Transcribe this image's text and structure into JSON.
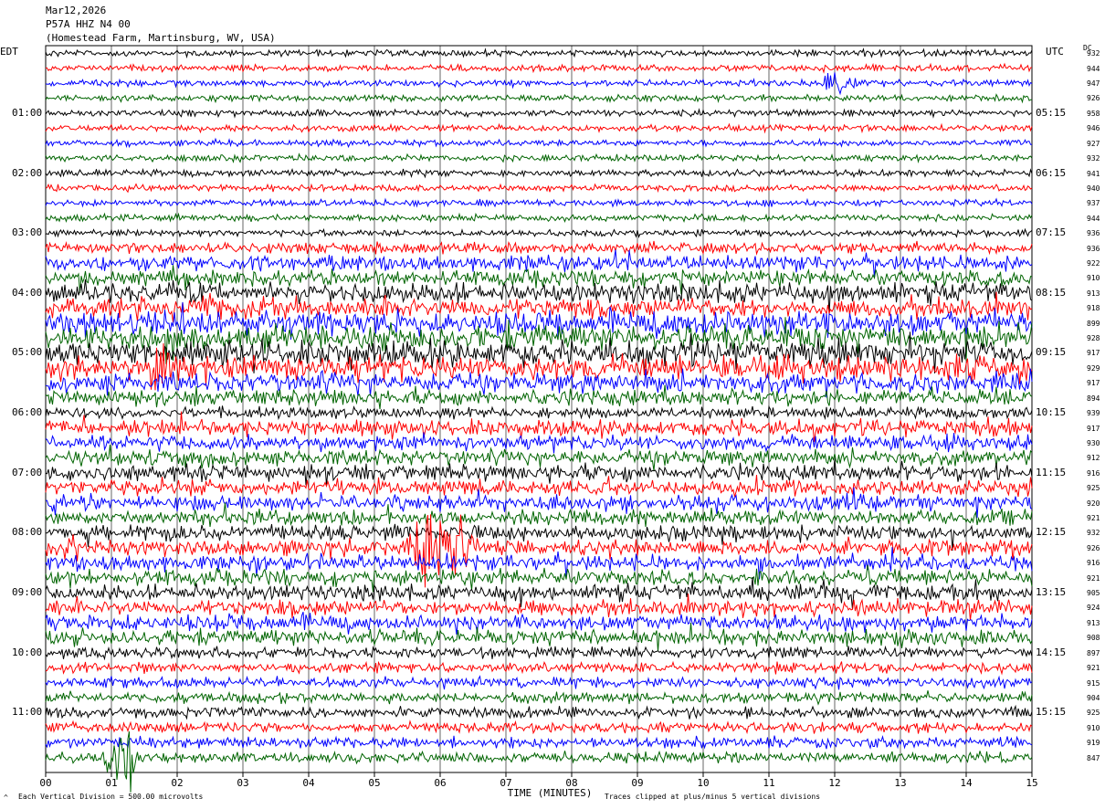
{
  "header": {
    "date": "Mar12,2026",
    "station": "P57A HHZ N4 00",
    "location": "(Homestead Farm, Martinsburg, WV, USA)"
  },
  "left_timezone": "EDT",
  "right_timezone": "UTC",
  "dc_label": "DC",
  "footer": {
    "scale_note": "Each Vertical Division = 500.00 microvolts",
    "clip_note": "Traces clipped at plus/minus 5 vertical divisions",
    "corner_mark": "^"
  },
  "chart_data": {
    "type": "line",
    "title": "",
    "xlabel": "TIME (MINUTES)",
    "xlim": [
      0,
      15
    ],
    "x_ticks": [
      "00",
      "01",
      "02",
      "03",
      "04",
      "05",
      "06",
      "07",
      "08",
      "09",
      "10",
      "11",
      "12",
      "13",
      "14",
      "15"
    ],
    "left_hour_labels": [
      "01:00",
      "02:00",
      "03:00",
      "04:00",
      "05:00",
      "06:00",
      "07:00",
      "08:00",
      "09:00",
      "10:00",
      "11:00"
    ],
    "right_hour_labels": [
      "05:15",
      "06:15",
      "07:15",
      "08:15",
      "09:15",
      "10:15",
      "11:15",
      "12:15",
      "13:15",
      "14:15",
      "15:15"
    ],
    "trace_colors": [
      "#000000",
      "#ff0000",
      "#0000ff",
      "#006400"
    ],
    "dc_offsets": [
      932,
      944,
      947,
      926,
      958,
      946,
      927,
      932,
      941,
      940,
      937,
      944,
      936,
      936,
      922,
      910,
      913,
      918,
      899,
      928,
      917,
      929,
      917,
      894,
      939,
      917,
      930,
      912,
      916,
      925,
      920,
      921,
      932,
      926,
      916,
      921,
      905,
      924,
      913,
      908,
      897,
      921,
      915,
      904,
      925,
      910,
      919,
      847
    ],
    "trace_activity": [
      1,
      1,
      1,
      1,
      1,
      1,
      1,
      1,
      1,
      1,
      1,
      1,
      1,
      2,
      3,
      3,
      4,
      4,
      5,
      5,
      5,
      5,
      4,
      3,
      2,
      3,
      3,
      3,
      3,
      3,
      3,
      3,
      3,
      3,
      3,
      3,
      3,
      3,
      3,
      3,
      2,
      2,
      2,
      2,
      2,
      2,
      2,
      2
    ],
    "events": [
      {
        "trace": 2,
        "minute": 12.0,
        "amp": 2
      },
      {
        "trace": 21,
        "minute": 1.8,
        "amp": 3
      },
      {
        "trace": 33,
        "minute": 5.8,
        "amp": 6
      },
      {
        "trace": 33,
        "minute": 6.25,
        "amp": 4
      },
      {
        "trace": 47,
        "minute": 1.2,
        "amp": 6
      }
    ]
  }
}
